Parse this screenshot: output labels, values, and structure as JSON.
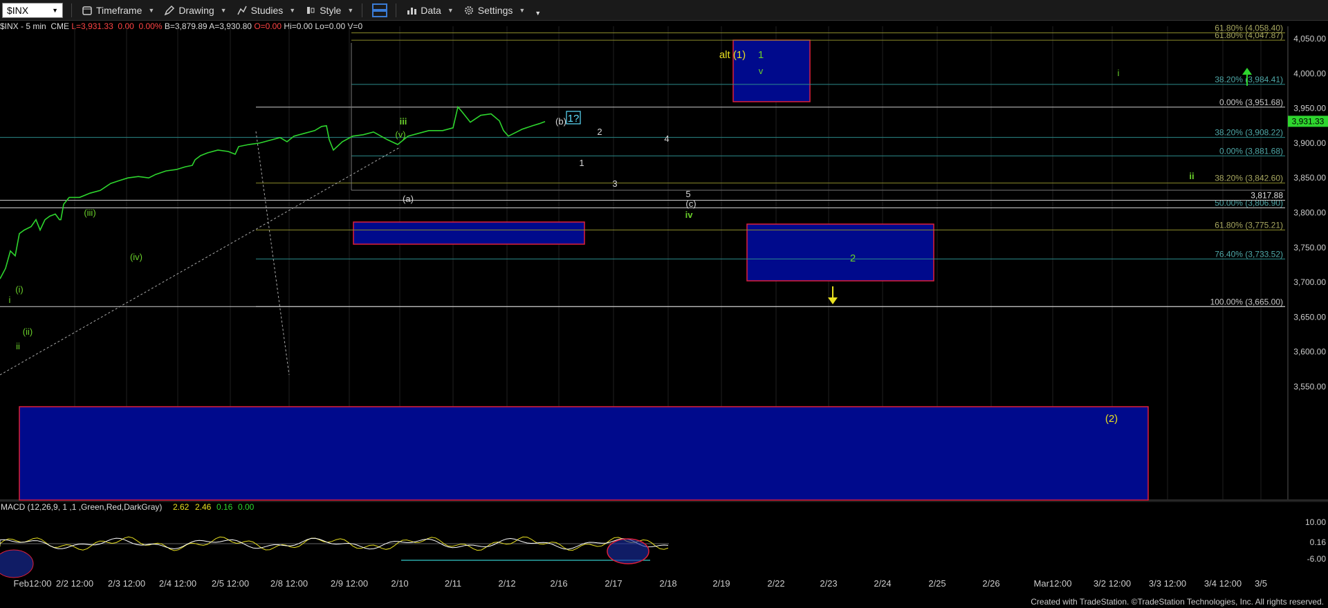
{
  "toolbar": {
    "symbol": "$INX",
    "timeframe": "Timeframe",
    "drawing": "Drawing",
    "studies": "Studies",
    "style": "Style",
    "data": "Data",
    "settings": "Settings"
  },
  "infobar": {
    "symbol_desc": "$INX - 5 min  CME",
    "last": "L=3,931.33  0.00  0.00%",
    "bid": "B=3,879.89",
    "ask": "A=3,930.80",
    "open": "O=0.00",
    "hi": "Hi=0.00",
    "lo": "Lo=0.00",
    "vol": "V=0"
  },
  "footer": "Created with TradeStation. ©TradeStation Technologies, Inc. All rights reserved.",
  "colors": {
    "price": "#2ed62e",
    "box_fill": "#000a8c",
    "box_border": "#e01f3a",
    "fib_teal": "#2b8c8c",
    "fib_olive": "#8c8c2b",
    "white_line": "#d0d0d0",
    "label_green": "#6ad02a",
    "label_yellow": "#e8e020",
    "label_white": "#d8d8d8",
    "last_price_bg": "#2ed62e"
  },
  "chart_data": {
    "type": "line",
    "title": "$INX - 5 min",
    "y_axis_labels": [
      "4,050.00",
      "4,000.00",
      "3,950.00",
      "3,900.00",
      "3,850.00",
      "3,800.00",
      "3,750.00",
      "3,700.00",
      "3,650.00",
      "3,600.00",
      "3,550.00"
    ],
    "ylim": [
      3520,
      4070
    ],
    "x_axis_labels": [
      "Feb12:00",
      "2/2 12:00",
      "2/3 12:00",
      "2/4 12:00",
      "2/5 12:00",
      "2/8 12:00",
      "2/9 12:00",
      "2/10",
      "2/11",
      "2/12",
      "2/16",
      "2/17",
      "2/18",
      "2/19",
      "2/22",
      "2/23",
      "2/24",
      "2/25",
      "2/26",
      "Mar12:00",
      "3/2 12:00",
      "3/3 12:00",
      "3/4 12:00",
      "3/5"
    ],
    "last_price": "3,931.33",
    "series": [
      {
        "values": [
          [
            0,
            3705
          ],
          [
            8,
            3720
          ],
          [
            15,
            3745
          ],
          [
            22,
            3738
          ],
          [
            28,
            3770
          ],
          [
            35,
            3775
          ],
          [
            45,
            3780
          ],
          [
            52,
            3790
          ],
          [
            58,
            3775
          ],
          [
            65,
            3790
          ],
          [
            72,
            3795
          ],
          [
            80,
            3798
          ],
          [
            86,
            3790
          ],
          [
            88,
            3790
          ],
          [
            92,
            3812
          ],
          [
            100,
            3822
          ],
          [
            115,
            3822
          ],
          [
            130,
            3828
          ],
          [
            145,
            3832
          ],
          [
            160,
            3842
          ],
          [
            172,
            3846
          ],
          [
            185,
            3850
          ],
          [
            200,
            3852
          ],
          [
            215,
            3850
          ],
          [
            225,
            3855
          ],
          [
            240,
            3860
          ],
          [
            255,
            3862
          ],
          [
            268,
            3866
          ],
          [
            278,
            3868
          ],
          [
            282,
            3876
          ],
          [
            290,
            3882
          ],
          [
            300,
            3886
          ],
          [
            315,
            3890
          ],
          [
            330,
            3888
          ],
          [
            340,
            3884
          ],
          [
            345,
            3895
          ],
          [
            360,
            3898
          ],
          [
            375,
            3900
          ],
          [
            390,
            3904
          ],
          [
            405,
            3908
          ],
          [
            415,
            3902
          ],
          [
            425,
            3910
          ],
          [
            440,
            3914
          ],
          [
            455,
            3918
          ],
          [
            465,
            3924
          ],
          [
            472,
            3925
          ],
          [
            476,
            3905
          ],
          [
            482,
            3890
          ],
          [
            495,
            3902
          ],
          [
            510,
            3910
          ],
          [
            525,
            3912
          ],
          [
            540,
            3916
          ],
          [
            560,
            3905
          ],
          [
            575,
            3898
          ],
          [
            590,
            3910
          ],
          [
            605,
            3914
          ],
          [
            620,
            3918
          ],
          [
            640,
            3918
          ],
          [
            655,
            3922
          ],
          [
            662,
            3952
          ],
          [
            668,
            3945
          ],
          [
            680,
            3930
          ],
          [
            695,
            3940
          ],
          [
            710,
            3942
          ],
          [
            722,
            3932
          ],
          [
            728,
            3918
          ],
          [
            735,
            3910
          ],
          [
            745,
            3915
          ],
          [
            755,
            3920
          ],
          [
            770,
            3925
          ],
          [
            780,
            3928
          ],
          [
            788,
            3931
          ]
        ]
      }
    ],
    "fib_levels": [
      {
        "label": "61.80% (4,058.40)",
        "value": 4058.4
      },
      {
        "label": "61.80% (4,047.87)",
        "value": 4047.87
      },
      {
        "label": "38.20% (3,984.41)",
        "value": 3984.41
      },
      {
        "label": "0.00% (3,951.68)",
        "value": 3951.68
      },
      {
        "label": "38.20% (3,908.22)",
        "value": 3908.22
      },
      {
        "label": "0.00% (3,881.68)",
        "value": 3881.68
      },
      {
        "label": "38.20% (3,842.60)",
        "value": 3842.6
      },
      {
        "label": "50.00% (3,806.90)",
        "value": 3806.9
      },
      {
        "label": "61.80% (3,775.21)",
        "value": 3775.21
      },
      {
        "label": "76.40% (3,733.52)",
        "value": 3733.52
      },
      {
        "label": "100.00% (3,665.00)",
        "value": 3665.0
      }
    ],
    "level_marker": "3,817.88",
    "wave_labels": [
      "i",
      "(i)",
      "(ii)",
      "ii",
      "(iii)",
      "(iv)",
      "iii",
      "(v)",
      "(a)",
      "(b)",
      "1?",
      "1",
      "2",
      "3",
      "4",
      "5",
      "(c)",
      "iv",
      "alt (1)",
      "1",
      "v",
      "2",
      "ii",
      "i",
      "(2)"
    ],
    "macd": {
      "label": "MACD (12,26,9, 1 ,1 ,Green,Red,DarkGray)",
      "values": [
        "2.62",
        "2.46",
        "0.16",
        "0.00"
      ],
      "y_axis_labels": [
        "10.00",
        "0.16",
        "-6.00"
      ]
    }
  }
}
